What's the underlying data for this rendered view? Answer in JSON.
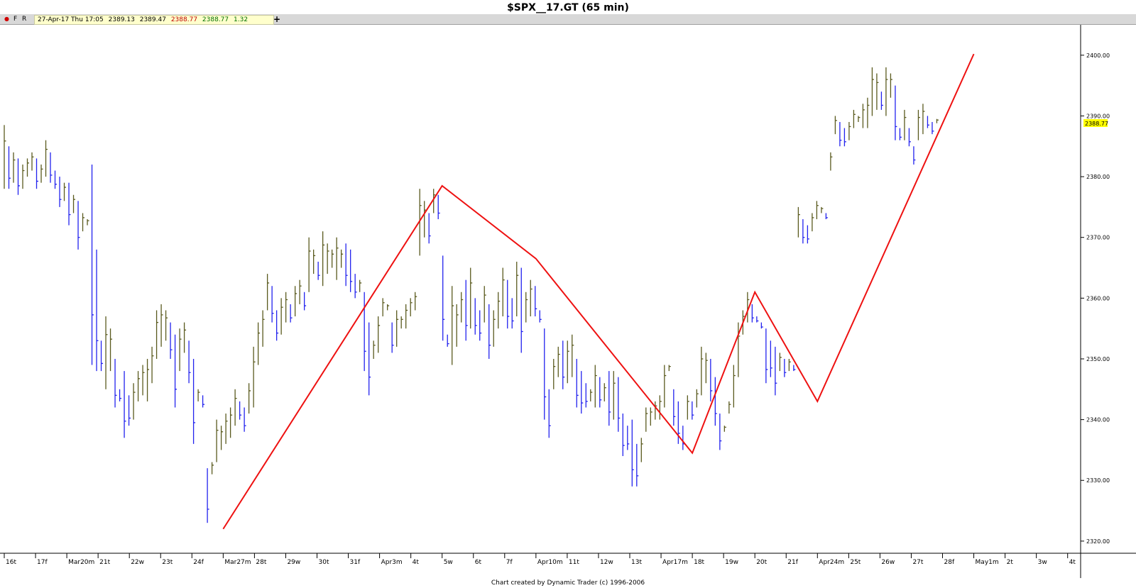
{
  "window": {
    "title": "$SPX__17.GT (65 min)"
  },
  "toolbar": {
    "marker_f": "F",
    "marker_r": "R",
    "plus": "+",
    "quote": {
      "datetime": "27-Apr-17 Thu 17:05",
      "open": "2389.13",
      "high": "2389.47",
      "low": "2388.77",
      "close": "2388.77",
      "change": "1.32"
    }
  },
  "footer": {
    "credit": "Chart created by Dynamic Trader  (c) 1996-2006"
  },
  "colors": {
    "up_bar": "#5a5a1e",
    "down_bar": "#2222ee",
    "swing_line": "#ee1111",
    "price_marker_bg": "#ffff00",
    "close_red": "#c00000",
    "close_green": "#007000"
  },
  "chart_data": {
    "type": "ohlc_bar",
    "symbol": "$SPX__17.GT",
    "interval": "65 min",
    "y_range": [
      2318,
      2405
    ],
    "y_ticks": [
      2320,
      2330,
      2340,
      2350,
      2360,
      2370,
      2380,
      2390,
      2400
    ],
    "y_tick_labels": [
      "2320.00",
      "2330.00",
      "2340.00",
      "2350.00",
      "2360.00",
      "2370.00",
      "2380.00",
      "2390.00",
      "2400.00"
    ],
    "last_price_label": "2388.77",
    "x_labels": [
      "16t",
      "17f",
      "Mar20m",
      "21t",
      "22w",
      "23t",
      "24f",
      "Mar27m",
      "28t",
      "29w",
      "30t",
      "31f",
      "Apr3m",
      "4t",
      "5w",
      "6t",
      "7f",
      "Apr10m",
      "11t",
      "12w",
      "13t",
      "Apr17m",
      "18t",
      "19w",
      "20t",
      "21f",
      "Apr24m",
      "25t",
      "26w",
      "27t",
      "28f",
      "May1m",
      "2t",
      "3w",
      "4t"
    ],
    "swing_line": [
      {
        "date": "Mar27m",
        "price": 2322.0
      },
      {
        "date": "5w",
        "price": 2378.5
      },
      {
        "date": "Apr10m",
        "price": 2366.5
      },
      {
        "date": "18t",
        "price": 2334.5
      },
      {
        "date": "20t",
        "price": 2361.0
      },
      {
        "date": "Apr24m",
        "price": 2343.0
      },
      {
        "date": "May1m",
        "price": 2400.2
      }
    ],
    "bars": [
      [
        2388.5,
        2378
      ],
      [
        2385,
        2378
      ],
      [
        2384,
        2379
      ],
      [
        2383,
        2377
      ],
      [
        2382,
        2378
      ],
      [
        2383,
        2380
      ],
      [
        2384,
        2381
      ],
      [
        2383,
        2378
      ],
      [
        2382,
        2379
      ],
      [
        2386,
        2380
      ],
      [
        2384,
        2379
      ],
      [
        2381,
        2378
      ],
      [
        2380,
        2375
      ],
      [
        2379,
        2376
      ],
      [
        2379,
        2372
      ],
      [
        2377,
        2374
      ],
      [
        2376,
        2368
      ],
      [
        2374,
        2371
      ],
      [
        2373,
        2372
      ],
      [
        2382,
        2349
      ],
      [
        2368,
        2348
      ],
      [
        2353,
        2348
      ],
      [
        2357,
        2345
      ],
      [
        2355,
        2348
      ],
      [
        2350,
        2342
      ],
      [
        2345,
        2343
      ],
      [
        2348,
        2337
      ],
      [
        2344,
        2339
      ],
      [
        2346,
        2340
      ],
      [
        2348,
        2343
      ],
      [
        2349,
        2344
      ],
      [
        2350,
        2343
      ],
      [
        2352,
        2346
      ],
      [
        2358,
        2350
      ],
      [
        2359,
        2352
      ],
      [
        2358,
        2353
      ],
      [
        2356,
        2350
      ],
      [
        2354,
        2342
      ],
      [
        2355,
        2348
      ],
      [
        2356,
        2351
      ],
      [
        2353,
        2346
      ],
      [
        2350,
        2336
      ],
      [
        2345,
        2343
      ],
      [
        2344,
        2342
      ],
      [
        2332,
        2323
      ],
      [
        2333,
        2331
      ],
      [
        2340,
        2333
      ],
      [
        2339,
        2335
      ],
      [
        2341,
        2336
      ],
      [
        2342,
        2337
      ],
      [
        2345,
        2339
      ],
      [
        2343,
        2340
      ],
      [
        2342,
        2338
      ],
      [
        2346,
        2341
      ],
      [
        2352,
        2342
      ],
      [
        2356,
        2349
      ],
      [
        2358,
        2352
      ],
      [
        2364,
        2358
      ],
      [
        2362,
        2356
      ],
      [
        2358,
        2353
      ],
      [
        2360,
        2354
      ],
      [
        2361,
        2356
      ],
      [
        2359,
        2356
      ],
      [
        2362,
        2357
      ],
      [
        2363,
        2359
      ],
      [
        2361,
        2358
      ],
      [
        2370,
        2361
      ],
      [
        2368,
        2364
      ],
      [
        2366,
        2363
      ],
      [
        2371,
        2362
      ],
      [
        2369,
        2364
      ],
      [
        2368,
        2365
      ],
      [
        2370,
        2363
      ],
      [
        2368,
        2365
      ],
      [
        2369,
        2362
      ],
      [
        2368,
        2361
      ],
      [
        2364,
        2360
      ],
      [
        2363,
        2361
      ],
      [
        2361,
        2348
      ],
      [
        2356,
        2344
      ],
      [
        2353,
        2350
      ],
      [
        2357,
        2351
      ],
      [
        2360,
        2357
      ],
      [
        2359,
        2358
      ],
      [
        2356,
        2351
      ],
      [
        2358,
        2352
      ],
      [
        2357,
        2355
      ],
      [
        2359,
        2355
      ],
      [
        2360,
        2357
      ],
      [
        2361,
        2358
      ],
      [
        2378,
        2367
      ],
      [
        2376,
        2370
      ],
      [
        2374,
        2369
      ],
      [
        2378,
        2374
      ],
      [
        2377,
        2373
      ],
      [
        2367,
        2353
      ],
      [
        2354,
        2352
      ],
      [
        2362,
        2349
      ],
      [
        2359,
        2352
      ],
      [
        2361,
        2356
      ],
      [
        2363,
        2353
      ],
      [
        2365,
        2355
      ],
      [
        2360,
        2354
      ],
      [
        2358,
        2353
      ],
      [
        2362,
        2356
      ],
      [
        2359,
        2350
      ],
      [
        2358,
        2352
      ],
      [
        2361,
        2355
      ],
      [
        2365,
        2357
      ],
      [
        2363,
        2355
      ],
      [
        2360,
        2355
      ],
      [
        2366,
        2357
      ],
      [
        2365,
        2351
      ],
      [
        2361,
        2356
      ],
      [
        2363,
        2357
      ],
      [
        2362,
        2357
      ],
      [
        2358,
        2356
      ],
      [
        2355,
        2340
      ],
      [
        2345,
        2337
      ],
      [
        2350,
        2345
      ],
      [
        2352,
        2347
      ],
      [
        2353,
        2345
      ],
      [
        2353,
        2346
      ],
      [
        2354,
        2347
      ],
      [
        2350,
        2342
      ],
      [
        2348,
        2341
      ],
      [
        2346,
        2342
      ],
      [
        2345,
        2343
      ],
      [
        2349,
        2342
      ],
      [
        2347,
        2342
      ],
      [
        2346,
        2343
      ],
      [
        2348,
        2339
      ],
      [
        2348,
        2340
      ],
      [
        2347,
        2338
      ],
      [
        2341,
        2334
      ],
      [
        2339,
        2335
      ],
      [
        2340,
        2329
      ],
      [
        2336,
        2329
      ],
      [
        2337,
        2333
      ],
      [
        2342,
        2338
      ],
      [
        2342,
        2339
      ],
      [
        2343,
        2340
      ],
      [
        2344,
        2340
      ],
      [
        2349,
        2342
      ],
      [
        2349,
        2348
      ],
      [
        2345,
        2339
      ],
      [
        2343,
        2336
      ],
      [
        2339,
        2335
      ],
      [
        2344,
        2340
      ],
      [
        2343,
        2340
      ],
      [
        2345,
        2342
      ],
      [
        2352,
        2344
      ],
      [
        2351,
        2346
      ],
      [
        2350,
        2343
      ],
      [
        2347,
        2339
      ],
      [
        2341,
        2335
      ],
      [
        2339,
        2338
      ],
      [
        2343,
        2341
      ],
      [
        2349,
        2342
      ],
      [
        2356,
        2347
      ],
      [
        2358,
        2354
      ],
      [
        2361,
        2356
      ],
      [
        2359,
        2356
      ],
      [
        2357,
        2356
      ],
      [
        2356,
        2355
      ],
      [
        2355,
        2346
      ],
      [
        2353,
        2347
      ],
      [
        2352,
        2344
      ],
      [
        2351,
        2348
      ],
      [
        2350,
        2347
      ],
      [
        2350,
        2348
      ],
      [
        2349,
        2348
      ],
      [
        2375,
        2370
      ],
      [
        2373,
        2369
      ],
      [
        2372,
        2369
      ],
      [
        2374,
        2371
      ],
      [
        2376,
        2373
      ],
      [
        2375,
        2374
      ],
      [
        2374,
        2373
      ],
      [
        2384,
        2381
      ],
      [
        2390,
        2387
      ],
      [
        2389,
        2385
      ],
      [
        2388,
        2385
      ],
      [
        2389,
        2386
      ],
      [
        2391,
        2388
      ],
      [
        2390,
        2389
      ],
      [
        2392,
        2388
      ],
      [
        2393,
        2388
      ],
      [
        2398,
        2390
      ],
      [
        2397,
        2391
      ],
      [
        2394,
        2391
      ],
      [
        2398,
        2390
      ],
      [
        2397,
        2393
      ],
      [
        2395,
        2386
      ],
      [
        2388,
        2386
      ],
      [
        2391,
        2386
      ],
      [
        2388,
        2385
      ],
      [
        2385,
        2382
      ],
      [
        2391,
        2386
      ],
      [
        2392,
        2387
      ],
      [
        2390,
        2388
      ],
      [
        2389,
        2387
      ],
      [
        2389.5,
        2388.8
      ]
    ]
  }
}
